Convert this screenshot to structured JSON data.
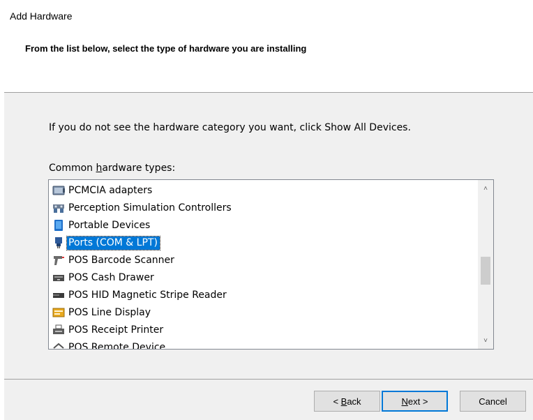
{
  "window": {
    "title": "Add Hardware"
  },
  "header": {
    "subtitle": "From the list below, select the type of hardware you are installing"
  },
  "body": {
    "instruction": "If you do not see the hardware category you want, click Show All Devices.",
    "list_label": {
      "before": "Common ",
      "accel": "h",
      "after": "ardware types:"
    }
  },
  "hardware_list": {
    "selected_index": 3,
    "items": [
      {
        "label": "PCMCIA adapters",
        "icon": "pcmcia-adapter-icon"
      },
      {
        "label": "Perception Simulation Controllers",
        "icon": "perception-controller-icon"
      },
      {
        "label": "Portable Devices",
        "icon": "portable-device-icon"
      },
      {
        "label": "Ports (COM & LPT)",
        "icon": "port-connector-icon"
      },
      {
        "label": "POS Barcode Scanner",
        "icon": "barcode-scanner-icon"
      },
      {
        "label": "POS Cash Drawer",
        "icon": "cash-drawer-icon"
      },
      {
        "label": "POS HID Magnetic Stripe Reader",
        "icon": "stripe-reader-icon"
      },
      {
        "label": "POS Line Display",
        "icon": "line-display-icon"
      },
      {
        "label": "POS Receipt Printer",
        "icon": "receipt-printer-icon"
      },
      {
        "label": "POS Remote Device",
        "icon": "remote-device-icon"
      }
    ],
    "scroll_position": 0.55
  },
  "buttons": {
    "back": {
      "prefix": "< ",
      "accel": "B",
      "rest": "ack"
    },
    "next": {
      "accel": "N",
      "rest": "ext >"
    },
    "cancel": "Cancel"
  }
}
